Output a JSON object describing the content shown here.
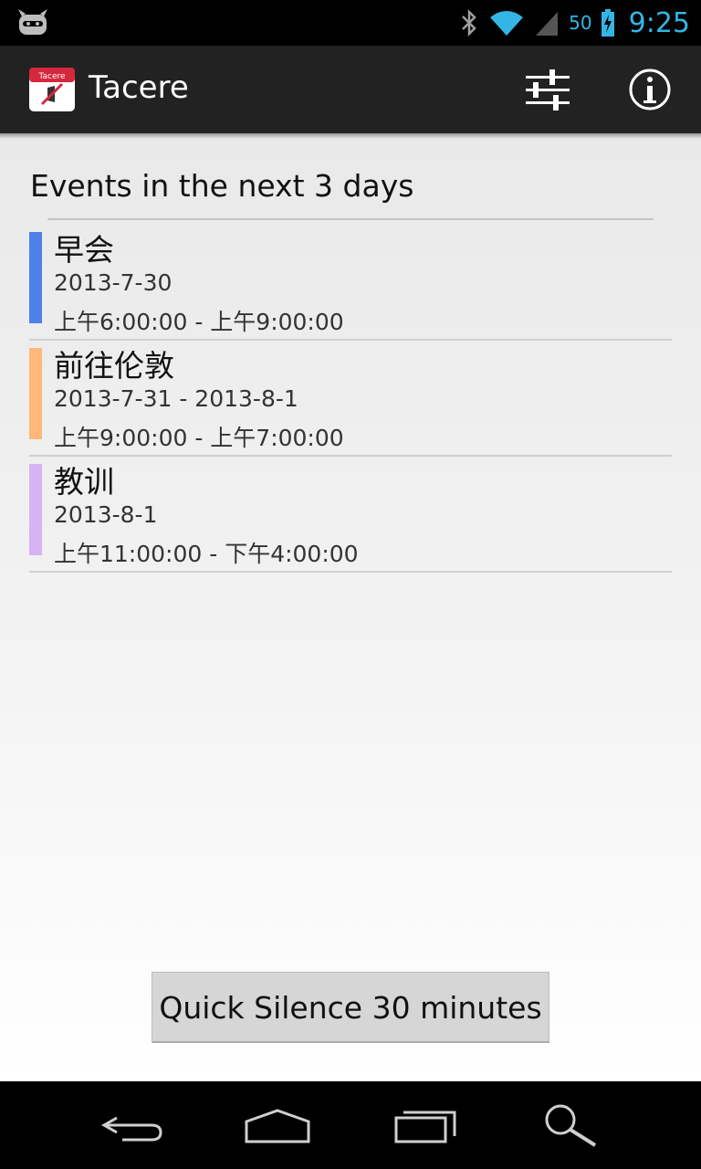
{
  "status_bar": {
    "time": "9:25",
    "battery_percent": "50",
    "icons": [
      "cyanogenmod-icon",
      "bluetooth-icon",
      "wifi-icon",
      "signal-icon",
      "battery-charging-icon"
    ]
  },
  "action_bar": {
    "title": "Tacere",
    "app_icon_text": "Tacere",
    "actions": [
      "settings-sliders-icon",
      "info-icon"
    ]
  },
  "main": {
    "section_title": "Events in the next 3 days",
    "events": [
      {
        "title": "早会",
        "date": "2013-7-30",
        "time": "上午6:00:00 - 上午9:00:00",
        "color": "#4f7fe8"
      },
      {
        "title": "前往伦敦",
        "date": "2013-7-31 - 2013-8-1",
        "time": "上午9:00:00 - 上午7:00:00",
        "color": "#ffb87a"
      },
      {
        "title": "教训",
        "date": "2013-8-1",
        "time": "上午11:00:00 - 下午4:00:00",
        "color": "#d7b2f5"
      }
    ],
    "quick_silence_label": "Quick Silence 30 minutes"
  },
  "nav_bar": {
    "buttons": [
      "back-icon",
      "home-icon",
      "recent-apps-icon",
      "search-icon"
    ]
  },
  "colors": {
    "accent": "#33b5e5",
    "action_bar_bg": "#222222"
  }
}
